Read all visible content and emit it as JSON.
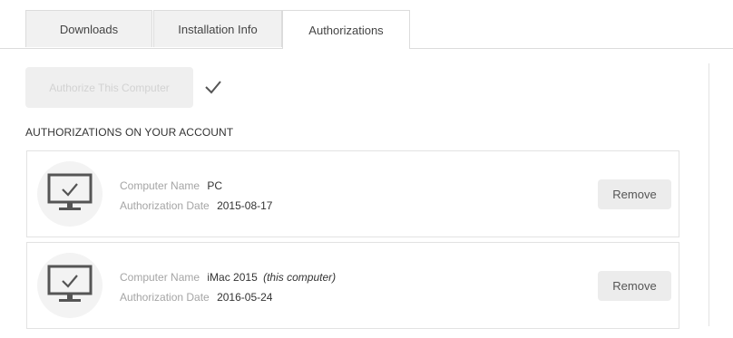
{
  "tabs": [
    {
      "label": "Downloads",
      "active": false
    },
    {
      "label": "Installation Info",
      "active": false
    },
    {
      "label": "Authorizations",
      "active": true
    }
  ],
  "authorize": {
    "button_label": "Authorize This Computer",
    "disabled": true,
    "status_icon": "checkmark-icon"
  },
  "section_title": "AUTHORIZATIONS ON YOUR ACCOUNT",
  "authorizations": [
    {
      "icon": "monitor-check-icon",
      "name_label": "Computer Name",
      "name_value": "PC",
      "name_note": "",
      "date_label": "Authorization Date",
      "date_value": "2015-08-17",
      "remove_label": "Remove"
    },
    {
      "icon": "monitor-check-icon",
      "name_label": "Computer Name",
      "name_value": "iMac 2015",
      "name_note": "(this computer)",
      "date_label": "Authorization Date",
      "date_value": "2016-05-24",
      "remove_label": "Remove"
    }
  ],
  "colors": {
    "tab_inactive_bg": "#f1f1f1",
    "border": "#dcdcdc",
    "label_gray": "#a5a5a5",
    "button_bg": "#ececec"
  }
}
